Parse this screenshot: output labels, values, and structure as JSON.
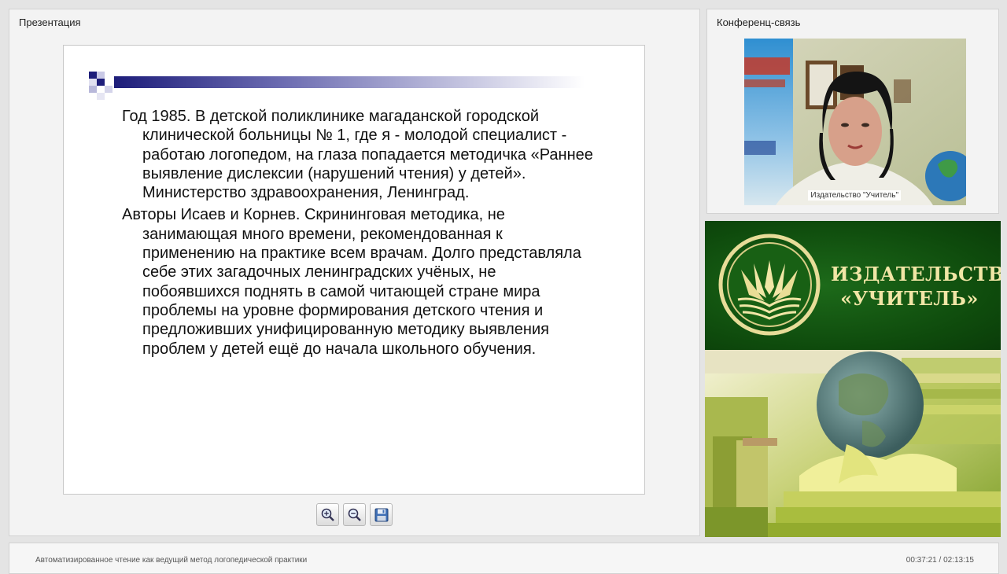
{
  "presentation": {
    "title": "Презентация",
    "slide": {
      "paragraphs": [
        "Год 1985.  В детской поликлинике магаданской городской клинической больницы № 1, где я - молодой специалист - работаю логопедом, на глаза попадается методичка «Раннее выявление дислексии (нарушений чтения) у детей». Министерство здравоохранения, Ленинград.",
        "Авторы Исаев и Корнев. Скрининговая методика, не занимающая много времени, рекомендованная к применению на практике всем врачам. Долго представляла себе этих загадочных ленинградских учёных, не побоявшихся поднять в самой читающей стране мира   проблемы на  уровне формирования детского чтения и предложивших унифицированную методику  выявления проблем у детей ещё до начала школьного обучения."
      ]
    },
    "toolbar": {
      "zoom_in_icon": "zoom-in-icon",
      "zoom_out_icon": "zoom-out-icon",
      "save_icon": "floppy-disk-icon"
    }
  },
  "conference": {
    "title": "Конференц-связь",
    "participant_name": "Издательство \"Учитель\""
  },
  "branding": {
    "name_line1": "ИЗДАТЕЛЬСТВО",
    "name_line2": "«УЧИТЕЛЬ»",
    "colors": {
      "green": "#0e4a0c",
      "gold": "#f1e6a6"
    }
  },
  "footer": {
    "lecture_title": "Автоматизированное чтение как ведущий метод логопедической практики",
    "time_current": "00:37:21",
    "time_total": "02:13:15",
    "time_separator": " / "
  }
}
